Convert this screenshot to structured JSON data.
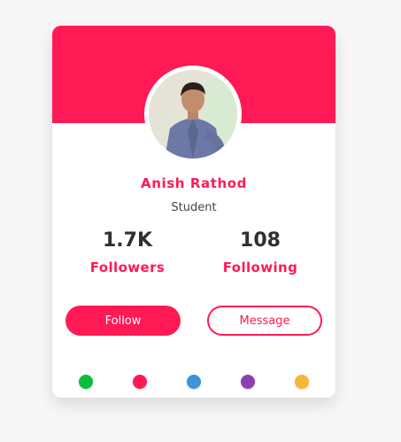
{
  "colors": {
    "accent": "#ff1a55",
    "theme_swatches": [
      "#0bbd3a",
      "#ff1a55",
      "#3b95d8",
      "#8d3fb0",
      "#f8b637"
    ]
  },
  "profile": {
    "name": "Anish Rathod",
    "role": "Student",
    "avatar_icon": "user-photo"
  },
  "stats": {
    "followers": {
      "value": "1.7K",
      "label": "Followers"
    },
    "following": {
      "value": "108",
      "label": "Following"
    }
  },
  "actions": {
    "follow_label": "Follow",
    "message_label": "Message"
  }
}
